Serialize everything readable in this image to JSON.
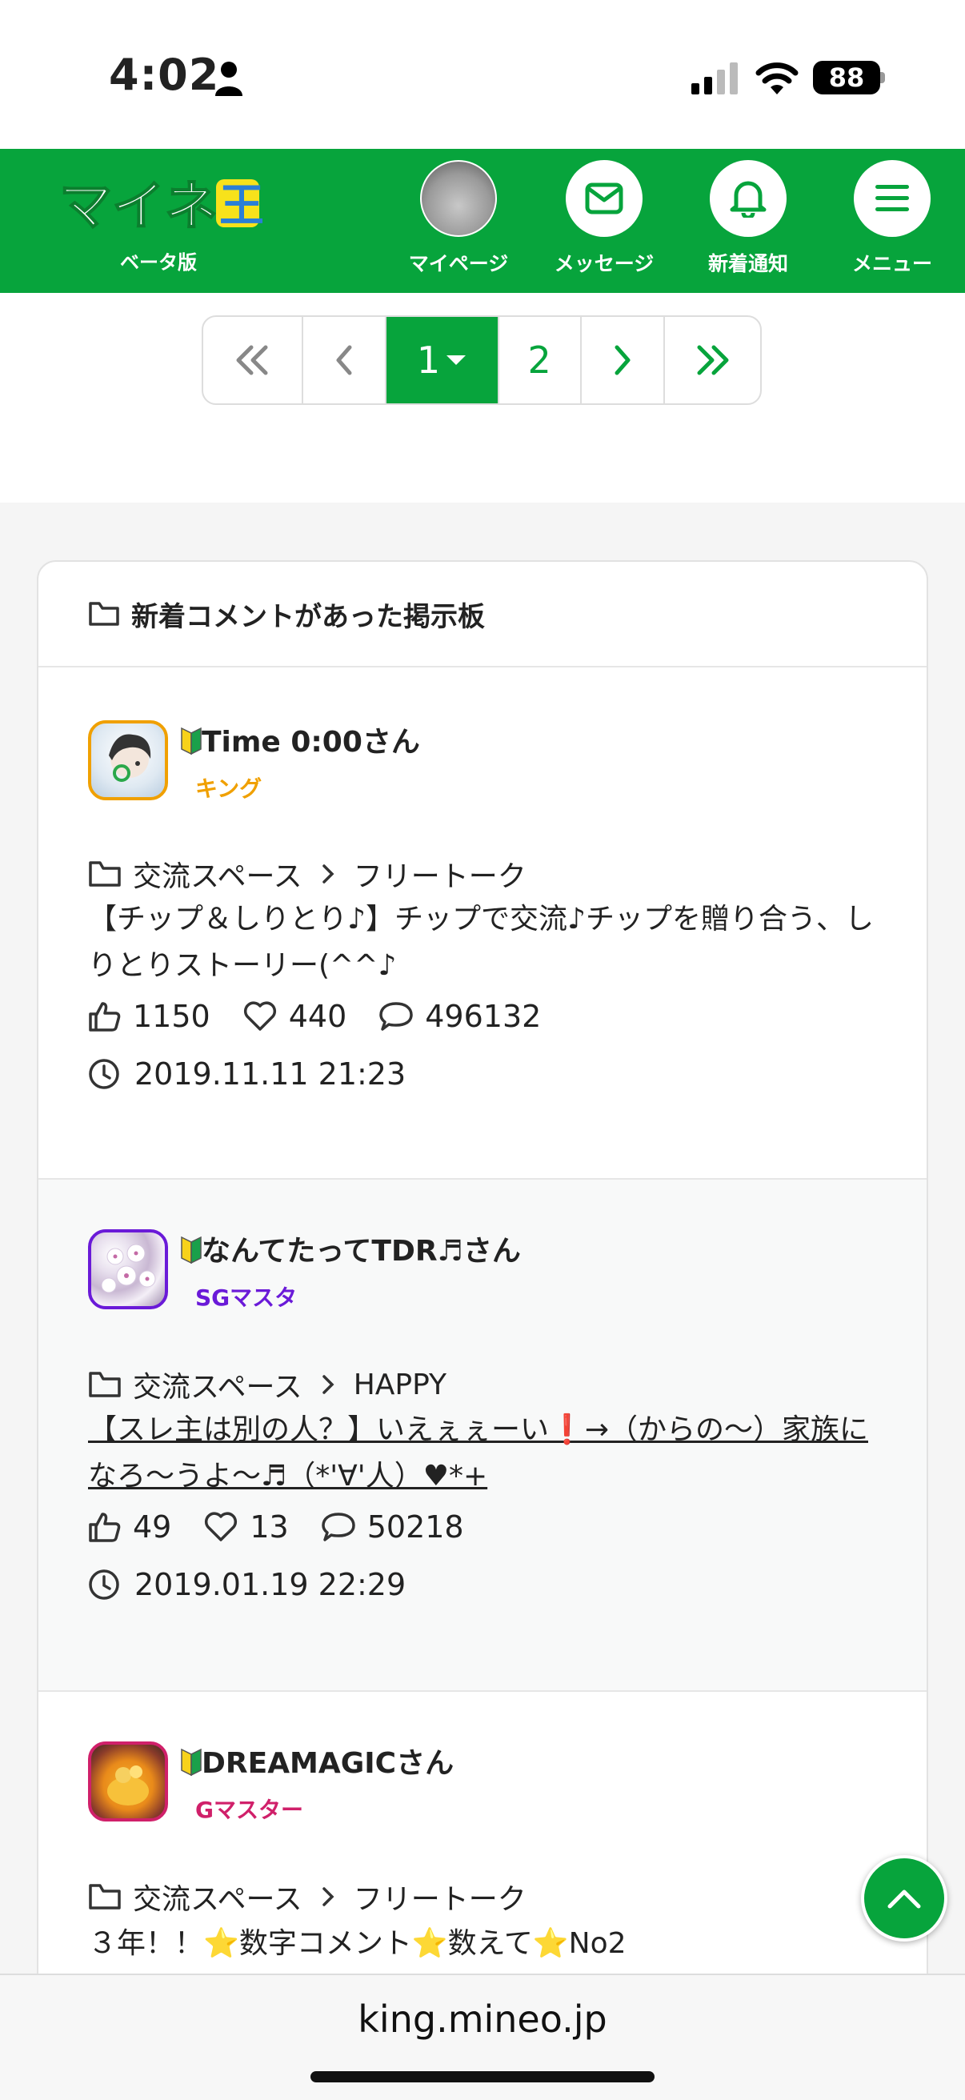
{
  "status": {
    "time": "4:02",
    "battery": "88"
  },
  "header": {
    "logo_text": "マイネ王",
    "logo_sub": "ベータ版",
    "nav": [
      {
        "label": "マイページ",
        "icon": "avatar"
      },
      {
        "label": "メッセージ",
        "icon": "envelope-icon"
      },
      {
        "label": "新着通知",
        "icon": "bell-icon"
      },
      {
        "label": "メニュー",
        "icon": "hamburger-icon"
      }
    ]
  },
  "pager": {
    "first": "«",
    "prev": "<",
    "current": "1",
    "next_page": "2",
    "next": ">",
    "last": "»"
  },
  "board": {
    "heading": "新着コメントがあった掲示板",
    "items": [
      {
        "user": "Time 0:00さん",
        "rank": "キング",
        "rank_color": "#f0a000",
        "category": "交流スペース",
        "subcategory": "フリートーク",
        "title": "【チップ＆しりとり♪】チップで交流♪チップを贈り合う、しりとりストーリー(^^♪",
        "likes": "1150",
        "favorites": "440",
        "comments": "496132",
        "date": "2019.11.11 21:23"
      },
      {
        "user": "なんてたってTDR♬さん",
        "rank": "SGマスタ",
        "rank_color": "#6a1ad8",
        "category": "交流スペース",
        "subcategory": "HAPPY",
        "title": "【スレ主は別の人？】いえぇぇーい❗️→（からの〜）家族になろ〜うよ〜♬（*'∀'人）♥*+",
        "likes": "49",
        "favorites": "13",
        "comments": "50218",
        "date": "2019.01.19 22:29"
      },
      {
        "user": "DREAMAGICさん",
        "rank": "Gマスター",
        "rank_color": "#d0206a",
        "category": "交流スペース",
        "subcategory": "フリートーク",
        "title": "３年！！⭐数字コメント⭐数えて⭐No2"
      }
    ]
  },
  "browser": {
    "url": "king.mineo.jp"
  },
  "colors": {
    "brand_green": "#07a43c"
  }
}
